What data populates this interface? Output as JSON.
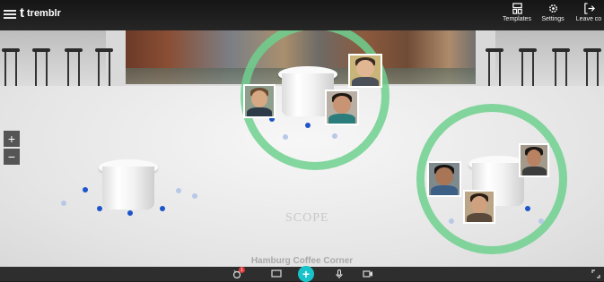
{
  "app": {
    "name": "tremblr",
    "logo_glyph": "t"
  },
  "topbar": {
    "actions": [
      {
        "label": "Templates",
        "icon": "templates-icon"
      },
      {
        "label": "Settings",
        "icon": "gear-icon"
      },
      {
        "label": "Leave co",
        "icon": "exit-icon"
      }
    ]
  },
  "room": {
    "name": "Hamburg Coffee Corner",
    "watermark": "SCOPE"
  },
  "zoom": {
    "in_label": "+",
    "out_label": "−"
  },
  "bottombar": {
    "add_label": "+",
    "notification_count": "1",
    "accent_color": "#18c3c9"
  },
  "colors": {
    "active_ring": "#6fd08e",
    "seat_dot": "#1e55c8"
  }
}
